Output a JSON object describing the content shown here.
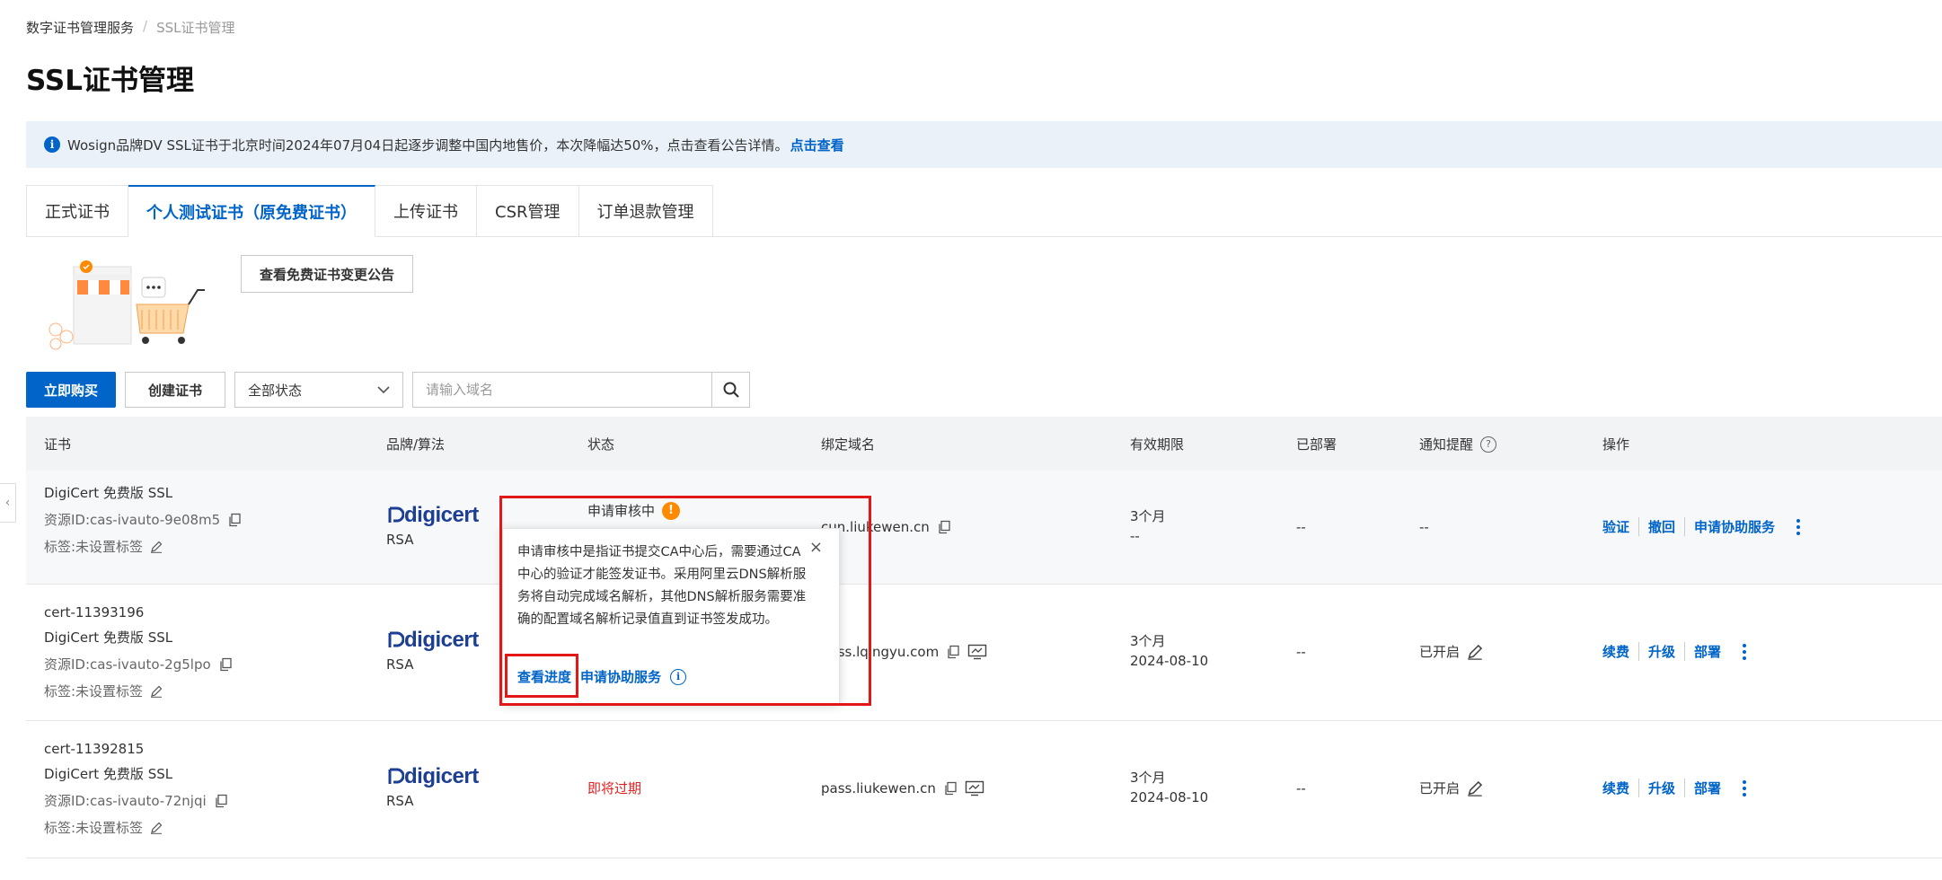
{
  "breadcrumb": {
    "parent": "数字证书管理服务",
    "separator": "/",
    "current": "SSL证书管理"
  },
  "page_title": "SSL证书管理",
  "notice": {
    "text": "Wosign品牌DV SSL证书于北京时间2024年07月04日起逐步调整中国内地售价，本次降幅达50%，点击查看公告详情。",
    "link": "点击查看"
  },
  "tabs": [
    "正式证书",
    "个人测试证书（原免费证书）",
    "上传证书",
    "CSR管理",
    "订单退款管理"
  ],
  "active_tab": 1,
  "free_notice_button": "查看免费证书变更公告",
  "toolbar": {
    "buy_now": "立即购买",
    "create_cert": "创建证书",
    "status_select": "全部状态",
    "search_placeholder": "请输入域名"
  },
  "table": {
    "headers": [
      "证书",
      "品牌/算法",
      "状态",
      "绑定域名",
      "有效期限",
      "已部署",
      "通知提醒",
      "操作"
    ],
    "rows": [
      {
        "cert_id": "",
        "name": "DigiCert 免费版 SSL",
        "resource_id": "资源ID:cas-ivauto-9e08m5",
        "tag": "标签:未设置标签",
        "brand": "digicert",
        "algorithm": "RSA",
        "status": "申请审核中",
        "domain": "cun.liukewen.cn",
        "validity": "3个月",
        "expiry": "--",
        "deployed": "--",
        "notify": "--",
        "ops": [
          "验证",
          "撤回",
          "申请协助服务"
        ]
      },
      {
        "cert_id": "cert-11393196",
        "name": "DigiCert 免费版 SSL",
        "resource_id": "资源ID:cas-ivauto-2g5lpo",
        "tag": "标签:未设置标签",
        "brand": "digicert",
        "algorithm": "RSA",
        "status": "",
        "domain": "pass.lqingyu.com",
        "validity": "3个月",
        "expiry": "2024-08-10",
        "deployed": "--",
        "notify": "已开启",
        "ops": [
          "续费",
          "升级",
          "部署"
        ]
      },
      {
        "cert_id": "cert-11392815",
        "name": "DigiCert 免费版 SSL",
        "resource_id": "资源ID:cas-ivauto-72njqi",
        "tag": "标签:未设置标签",
        "brand": "digicert",
        "algorithm": "RSA",
        "status": "即将过期",
        "domain": "pass.liukewen.cn",
        "validity": "3个月",
        "expiry": "2024-08-10",
        "deployed": "--",
        "notify": "已开启",
        "ops": [
          "续费",
          "升级",
          "部署"
        ]
      }
    ]
  },
  "popover": {
    "text": "申请审核中是指证书提交CA中心后，需要通过CA中心的验证才能签发证书。采用阿里云DNS解析服务将自动完成域名解析，其他DNS解析服务需要准确的配置域名解析记录值直到证书签发成功。",
    "view_progress": "查看进度",
    "assist_service": "申请协助服务"
  },
  "colors": {
    "primary": "#0064c8",
    "warning": "#ff8a00",
    "danger": "#e02020",
    "highlight_box": "#e21818",
    "digicert": "#1c3f94"
  }
}
